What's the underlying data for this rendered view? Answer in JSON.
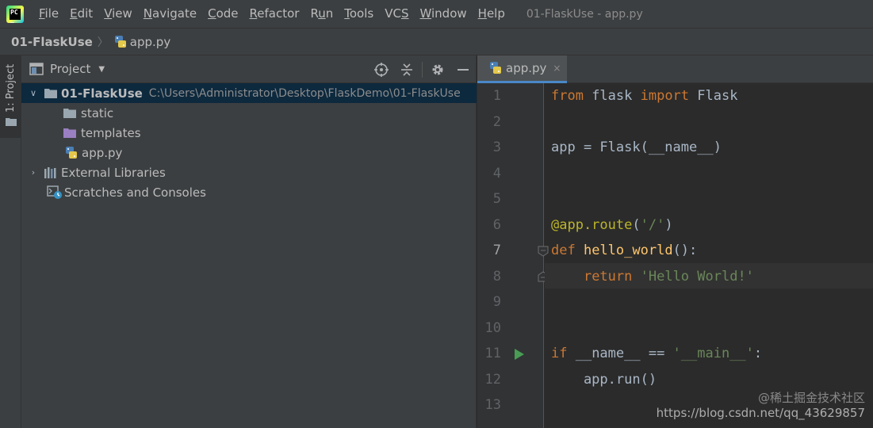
{
  "menubar": {
    "items": [
      {
        "prefix": "",
        "u": "F",
        "rest": "ile"
      },
      {
        "prefix": "",
        "u": "E",
        "rest": "dit"
      },
      {
        "prefix": "",
        "u": "V",
        "rest": "iew"
      },
      {
        "prefix": "",
        "u": "N",
        "rest": "avigate"
      },
      {
        "prefix": "",
        "u": "C",
        "rest": "ode"
      },
      {
        "prefix": "",
        "u": "R",
        "rest": "efactor"
      },
      {
        "prefix": "R",
        "u": "u",
        "rest": "n"
      },
      {
        "prefix": "",
        "u": "T",
        "rest": "ools"
      },
      {
        "prefix": "VC",
        "u": "S",
        "rest": ""
      },
      {
        "prefix": "",
        "u": "W",
        "rest": "indow"
      },
      {
        "prefix": "",
        "u": "H",
        "rest": "elp"
      }
    ],
    "window_title": "01-FlaskUse - app.py"
  },
  "breadcrumb": {
    "project": "01-FlaskUse",
    "file": "app.py"
  },
  "toolstrip": {
    "tab_label": "1: Project"
  },
  "project_panel": {
    "title": "Project",
    "tree": [
      {
        "label": "01-FlaskUse",
        "path": "C:\\Users\\Administrator\\Desktop\\FlaskDemo\\01-FlaskUse"
      },
      {
        "label": "static"
      },
      {
        "label": "templates"
      },
      {
        "label": "app.py"
      },
      {
        "label": "External Libraries"
      },
      {
        "label": "Scratches and Consoles"
      }
    ]
  },
  "editor": {
    "tab_label": "app.py",
    "tab_close": "×",
    "line_numbers": [
      "1",
      "2",
      "3",
      "4",
      "5",
      "6",
      "7",
      "8",
      "9",
      "10",
      "11",
      "12",
      "13"
    ],
    "current_line": 7
  },
  "watermark": {
    "community": "@稀土掘金技术社区",
    "url": "https://blog.csdn.net/qq_43629857"
  },
  "colors": {
    "keyword": "#cc7832",
    "string": "#6a8759",
    "decorator": "#bbb529",
    "function": "#ffc66d",
    "text": "#a9b7c6",
    "selection": "#0d293e",
    "run_marker": "#499c54"
  }
}
